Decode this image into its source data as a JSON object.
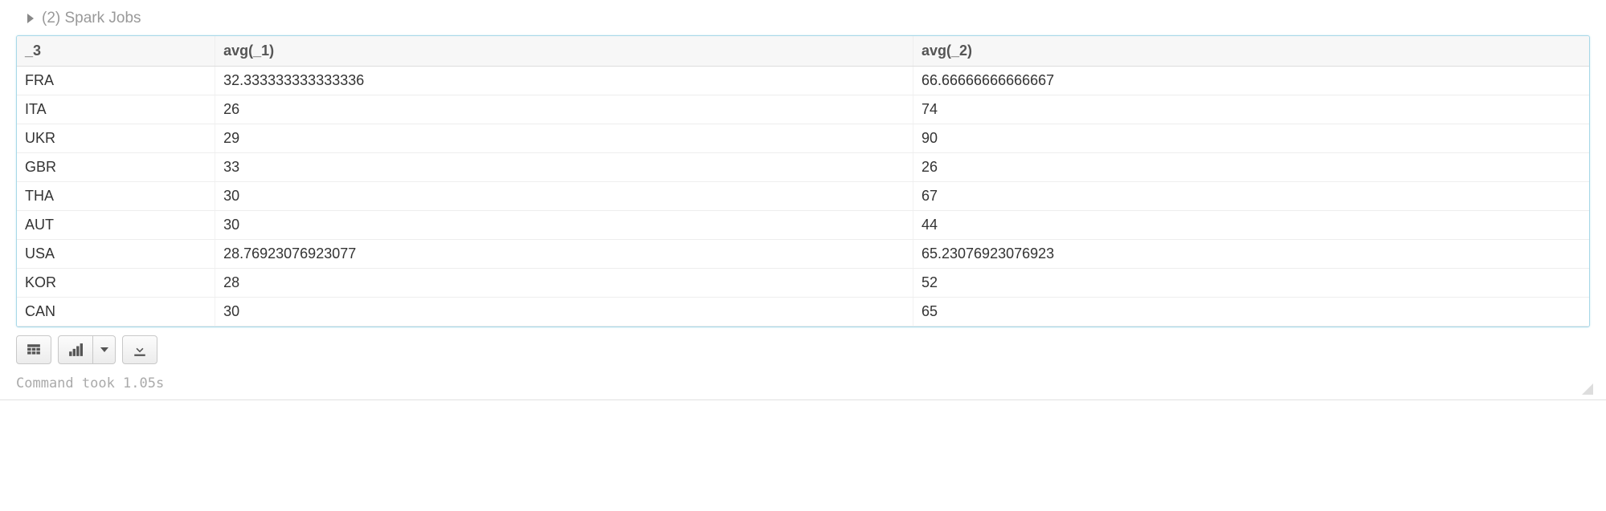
{
  "jobs_header": {
    "label": "(2) Spark Jobs"
  },
  "table": {
    "headers": [
      "_3",
      "avg(_1)",
      "avg(_2)"
    ],
    "rows": [
      {
        "c0": "FRA",
        "c1": "32.333333333333336",
        "c2": "66.66666666666667"
      },
      {
        "c0": "ITA",
        "c1": "26",
        "c2": "74"
      },
      {
        "c0": "UKR",
        "c1": "29",
        "c2": "90"
      },
      {
        "c0": "GBR",
        "c1": "33",
        "c2": "26"
      },
      {
        "c0": "THA",
        "c1": "30",
        "c2": "67"
      },
      {
        "c0": "AUT",
        "c1": "30",
        "c2": "44"
      },
      {
        "c0": "USA",
        "c1": "28.76923076923077",
        "c2": "65.23076923076923"
      },
      {
        "c0": "KOR",
        "c1": "28",
        "c2": "52"
      },
      {
        "c0": "CAN",
        "c1": "30",
        "c2": "65"
      }
    ]
  },
  "status": {
    "text": "Command took 1.05s"
  }
}
